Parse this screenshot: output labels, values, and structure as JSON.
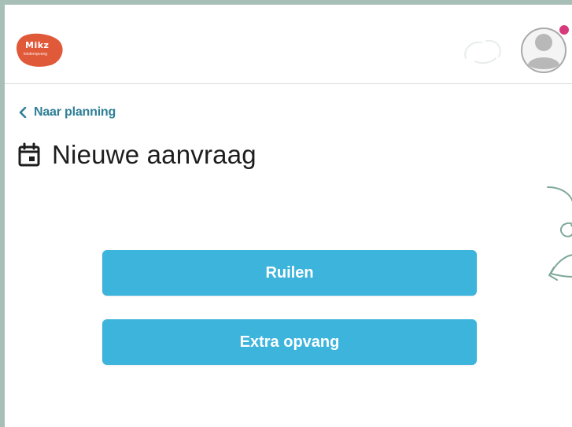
{
  "header": {
    "logo": {
      "text": "Mikz",
      "subtext": "kinderopvang",
      "color": "#e05a3a"
    },
    "avatar": {
      "icon": "user-avatar-icon",
      "notification_color": "#d63a7a"
    }
  },
  "nav": {
    "back_label": "Naar planning",
    "back_icon": "chevron-left-icon"
  },
  "page": {
    "title": "Nieuwe aanvraag",
    "title_icon": "calendar-icon"
  },
  "actions": {
    "ruilen_label": "Ruilen",
    "extra_opvang_label": "Extra opvang",
    "button_color": "#3db4db"
  },
  "colors": {
    "link": "#2f7f96",
    "frame": "#a7bfb6"
  }
}
